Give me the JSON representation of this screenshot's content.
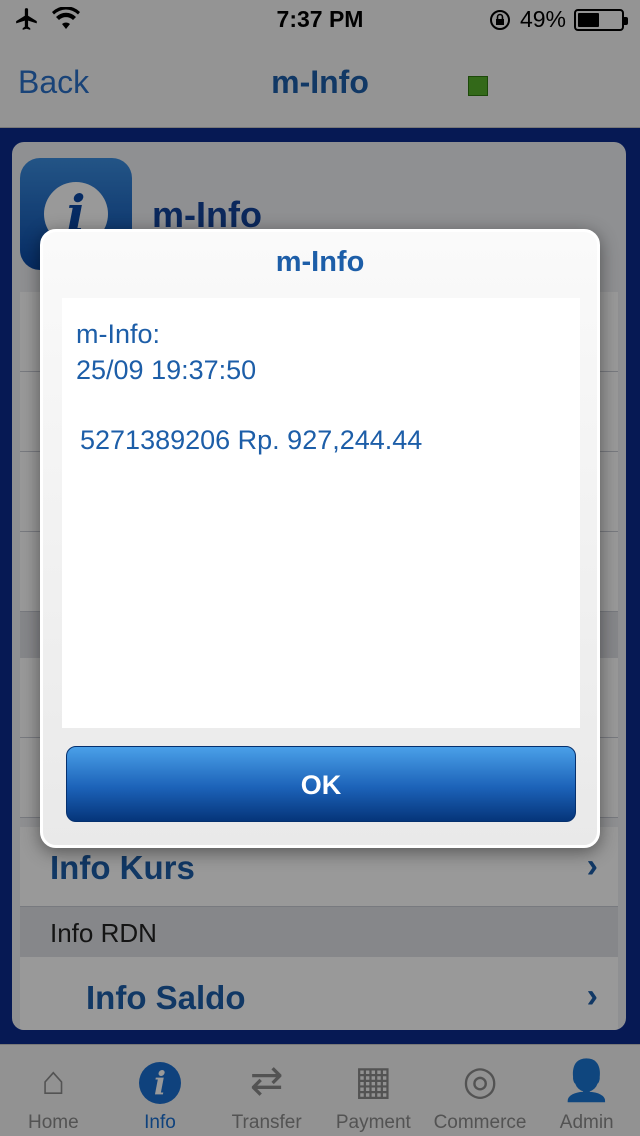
{
  "status_bar": {
    "time": "7:37 PM",
    "battery_percent": "49%",
    "battery_level": 0.49,
    "icons": [
      "airplane-icon",
      "wifi-icon",
      "rotation-lock-icon",
      "battery-icon"
    ]
  },
  "nav": {
    "back_label": "Back",
    "title": "m-Info",
    "status_color": "#55b02a"
  },
  "panel": {
    "title": "m-Info",
    "icon": "info-icon",
    "menu": {
      "info_kurs": "Info Kurs",
      "section_rdn": "Info RDN",
      "info_saldo": "Info Saldo"
    }
  },
  "dialog": {
    "title": "m-Info",
    "header_line": "m-Info:",
    "datetime": "25/09 19:37:50",
    "balance_line": "5271389206 Rp. 927,244.44",
    "ok_label": "OK"
  },
  "tabbar": {
    "tabs": [
      {
        "label": "Home",
        "icon": "home-icon"
      },
      {
        "label": "Info",
        "icon": "info-icon",
        "active": true
      },
      {
        "label": "Transfer",
        "icon": "transfer-icon"
      },
      {
        "label": "Payment",
        "icon": "payment-icon"
      },
      {
        "label": "Commerce",
        "icon": "commerce-icon"
      },
      {
        "label": "Admin",
        "icon": "admin-icon"
      }
    ]
  },
  "colors": {
    "accent": "#1d5ea8",
    "ok_button": "#1c62b8",
    "background_blue": "#0a2a8c"
  }
}
